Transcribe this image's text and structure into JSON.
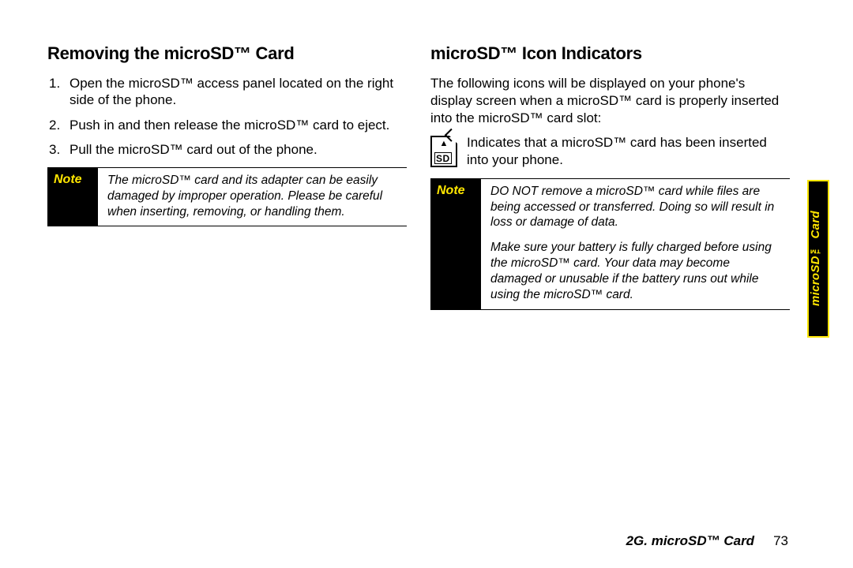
{
  "left": {
    "heading": "Removing the microSD™ Card",
    "steps": [
      "Open the microSD™ access panel located on the right side of the phone.",
      "Push in and then release the microSD™ card to eject.",
      "Pull the microSD™ card out of the phone."
    ],
    "note_label": "Note",
    "note_body": "The microSD™ card and its adapter can be easily damaged by improper operation. Please be careful when inserting, removing, or handling them."
  },
  "right": {
    "heading": "microSD™ Icon Indicators",
    "intro": "The following icons will be displayed on your phone's display screen when a microSD™ card is properly inserted into the microSD™ card slot:",
    "icon_arrow": "▲",
    "icon_label": "SD",
    "icon_text": "Indicates that a microSD™ card has been inserted into your phone.",
    "note_label": "Note",
    "note_body_1": "DO NOT remove a microSD™ card while files are being accessed or transferred. Doing so will result in loss or damage of data.",
    "note_body_2": "Make sure your battery is fully charged before using the microSD™ card. Your data may become damaged or unusable if the battery runs out while using the microSD™ card."
  },
  "side_tab": "microSD™ Card",
  "footer_section": "2G. microSD™ Card",
  "footer_page": "73"
}
